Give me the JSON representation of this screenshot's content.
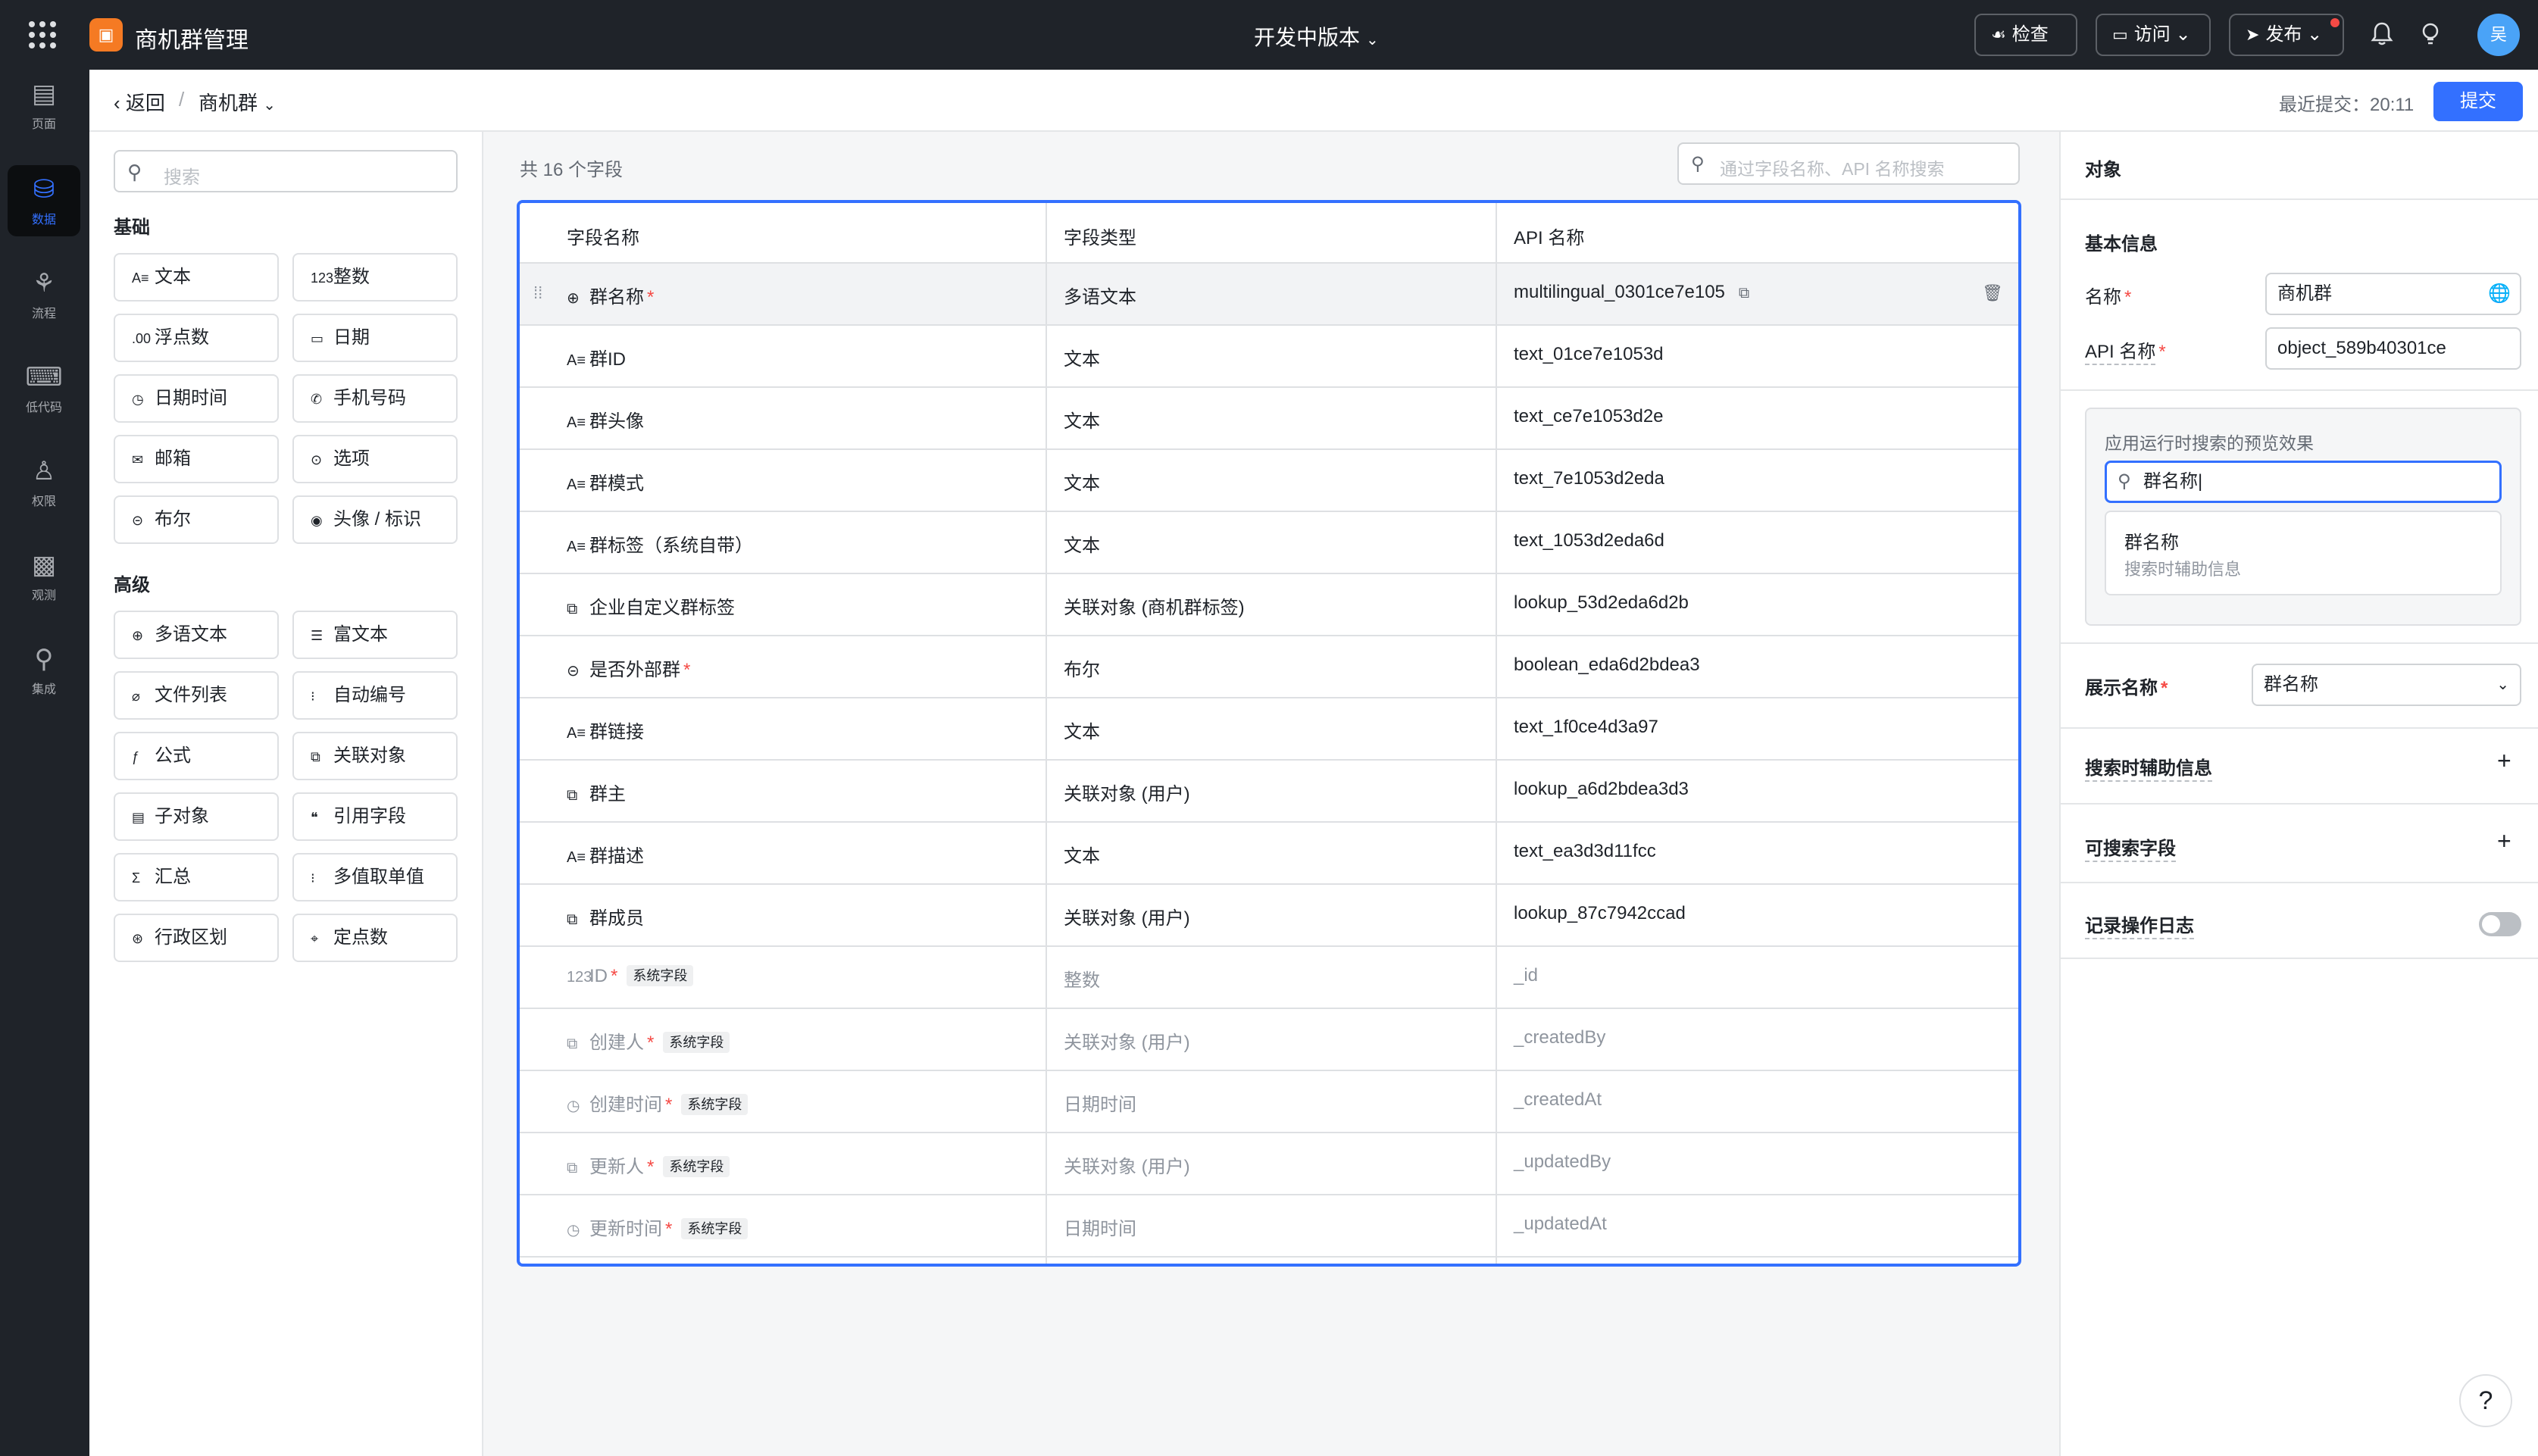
{
  "topbar": {
    "app_title": "商机群管理",
    "app_logo_icon": "briefcase-icon",
    "version": "开发中版本",
    "check_label": "检查",
    "visit_label": "访问",
    "publish_label": "发布",
    "avatar_text": "吴"
  },
  "leftnav": {
    "items": [
      {
        "label": "页面",
        "icon": "page-icon"
      },
      {
        "label": "数据",
        "icon": "database-icon",
        "active": true
      },
      {
        "label": "流程",
        "icon": "flow-icon"
      },
      {
        "label": "低代码",
        "icon": "code-icon"
      },
      {
        "label": "权限",
        "icon": "users-icon"
      },
      {
        "label": "观测",
        "icon": "monitor-icon"
      },
      {
        "label": "集成",
        "icon": "plugin-icon"
      }
    ]
  },
  "subheader": {
    "back_label": "返回",
    "separator": "/",
    "crumb": "商机群",
    "last_submit_label": "最近提交：",
    "last_submit_time": "20:11",
    "submit_label": "提交"
  },
  "palette": {
    "search_placeholder": "搜索",
    "basic_title": "基础",
    "advanced_title": "高级",
    "basic": [
      {
        "icon": "A≡",
        "label": "文本"
      },
      {
        "icon": "123",
        "label": "整数"
      },
      {
        "icon": ".00",
        "label": "浮点数"
      },
      {
        "icon": "▭",
        "label": "日期"
      },
      {
        "icon": "◷",
        "label": "日期时间"
      },
      {
        "icon": "✆",
        "label": "手机号码"
      },
      {
        "icon": "✉",
        "label": "邮箱"
      },
      {
        "icon": "⊙",
        "label": "选项"
      },
      {
        "icon": "⊝",
        "label": "布尔"
      },
      {
        "icon": "◉",
        "label": "头像 / 标识"
      }
    ],
    "advanced": [
      {
        "icon": "⊕",
        "label": "多语文本"
      },
      {
        "icon": "☰",
        "label": "富文本"
      },
      {
        "icon": "⌀",
        "label": "文件列表"
      },
      {
        "icon": "⁝",
        "label": "自动编号"
      },
      {
        "icon": "ƒ",
        "label": "公式"
      },
      {
        "icon": "⧉",
        "label": "关联对象"
      },
      {
        "icon": "▤",
        "label": "子对象"
      },
      {
        "icon": "❝",
        "label": "引用字段"
      },
      {
        "icon": "Σ",
        "label": "汇总"
      },
      {
        "icon": "⁝",
        "label": "多值取单值"
      },
      {
        "icon": "⊛",
        "label": "行政区划"
      },
      {
        "icon": "⌖",
        "label": "定点数"
      }
    ]
  },
  "center": {
    "count": "共 16 个字段",
    "search_placeholder": "通过字段名称、API 名称搜索",
    "headers": [
      "字段名称",
      "字段类型",
      "API 名称"
    ],
    "system_tag": "系统字段",
    "rows": [
      {
        "icon": "⊕",
        "name": "群名称",
        "required": true,
        "system": false,
        "type": "多语文本",
        "api": "multilingual_0301ce7e105"
      },
      {
        "icon": "A≡",
        "name": "群ID",
        "required": false,
        "system": false,
        "type": "文本",
        "api": "text_01ce7e1053d"
      },
      {
        "icon": "A≡",
        "name": "群头像",
        "required": false,
        "system": false,
        "type": "文本",
        "api": "text_ce7e1053d2e"
      },
      {
        "icon": "A≡",
        "name": "群模式",
        "required": false,
        "system": false,
        "type": "文本",
        "api": "text_7e1053d2eda"
      },
      {
        "icon": "A≡",
        "name": "群标签（系统自带）",
        "required": false,
        "system": false,
        "type": "文本",
        "api": "text_1053d2eda6d"
      },
      {
        "icon": "⧉",
        "name": "企业自定义群标签",
        "required": false,
        "system": false,
        "type": "关联对象 (商机群标签)",
        "api": "lookup_53d2eda6d2b"
      },
      {
        "icon": "⊝",
        "name": "是否外部群",
        "required": true,
        "system": false,
        "type": "布尔",
        "api": "boolean_eda6d2bdea3"
      },
      {
        "icon": "A≡",
        "name": "群链接",
        "required": false,
        "system": false,
        "type": "文本",
        "api": "text_1f0ce4d3a97"
      },
      {
        "icon": "⧉",
        "name": "群主",
        "required": false,
        "system": false,
        "type": "关联对象 (用户)",
        "api": "lookup_a6d2bdea3d3"
      },
      {
        "icon": "A≡",
        "name": "群描述",
        "required": false,
        "system": false,
        "type": "文本",
        "api": "text_ea3d3d11fcc"
      },
      {
        "icon": "⧉",
        "name": "群成员",
        "required": false,
        "system": false,
        "type": "关联对象 (用户)",
        "api": "lookup_87c7942ccad"
      },
      {
        "icon": "123",
        "name": "ID",
        "required": true,
        "system": true,
        "type": "整数",
        "api": "_id"
      },
      {
        "icon": "⧉",
        "name": "创建人",
        "required": true,
        "system": true,
        "type": "关联对象 (用户)",
        "api": "_createdBy"
      },
      {
        "icon": "◷",
        "name": "创建时间",
        "required": true,
        "system": true,
        "type": "日期时间",
        "api": "_createdAt"
      },
      {
        "icon": "⧉",
        "name": "更新人",
        "required": true,
        "system": true,
        "type": "关联对象 (用户)",
        "api": "_updatedBy"
      },
      {
        "icon": "◷",
        "name": "更新时间",
        "required": true,
        "system": true,
        "type": "日期时间",
        "api": "_updatedAt"
      }
    ]
  },
  "rpanel": {
    "title": "对象",
    "basic_info": "基本信息",
    "name_label": "名称",
    "name_value": "商机群",
    "api_label": "API 名称",
    "api_value": "object_589b40301ce",
    "preview_label": "应用运行时搜索的预览效果",
    "preview_input": "群名称",
    "preview_dd_title": "群名称",
    "preview_dd_sub": "搜索时辅助信息",
    "display_name_label": "展示名称",
    "display_name_value": "群名称",
    "search_aux_label": "搜索时辅助信息",
    "searchable_label": "可搜索字段",
    "log_label": "记录操作日志",
    "log_enabled": false
  },
  "colors": {
    "accent": "#3370ff",
    "topbar": "#1f2329",
    "required": "#f54a45",
    "app_logo": "#f57a23"
  }
}
